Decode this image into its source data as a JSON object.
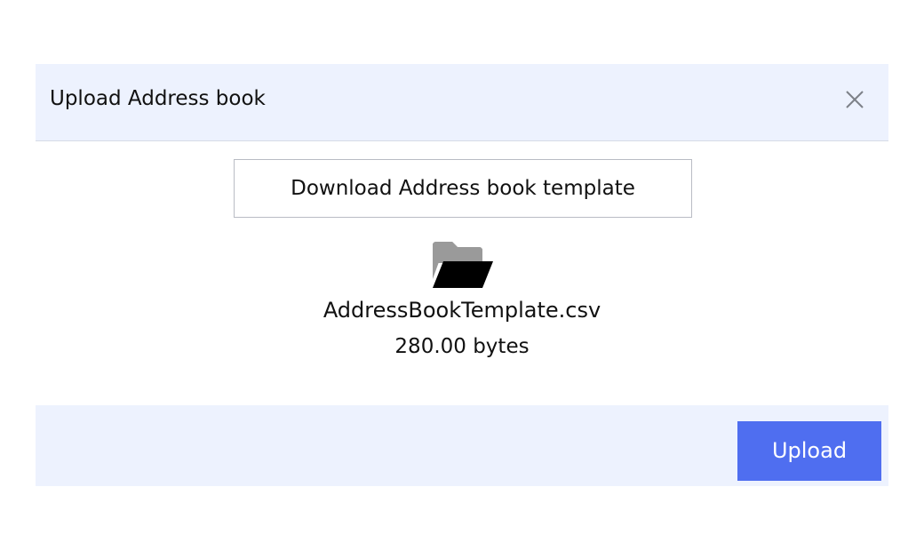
{
  "dialog": {
    "title": "Upload Address book",
    "close_icon": "close-icon"
  },
  "download": {
    "label": "Download Address book template"
  },
  "file": {
    "icon": "folder-open-icon",
    "name": "AddressBookTemplate.csv",
    "size": "280.00 bytes"
  },
  "footer": {
    "upload_label": "Upload"
  },
  "colors": {
    "header_bg": "#edf2fe",
    "footer_bg": "#edf2fe",
    "primary": "#4f6ef0",
    "folder_back": "#9a9a9a",
    "folder_front": "#000000"
  }
}
